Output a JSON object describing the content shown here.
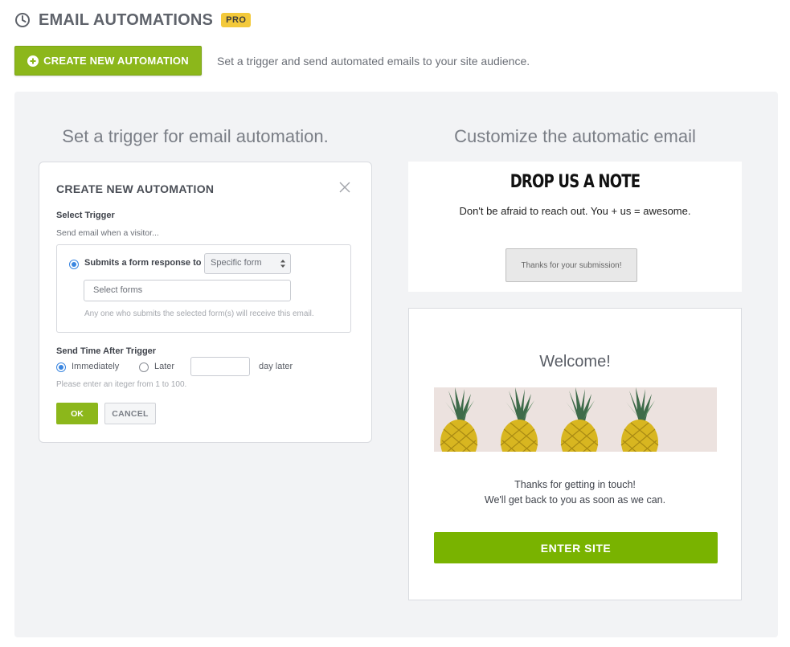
{
  "header": {
    "title": "EMAIL AUTOMATIONS",
    "badge": "PRO",
    "icon": "clock-icon"
  },
  "create": {
    "button_label": "CREATE NEW AUTOMATION",
    "description": "Set a trigger and send automated emails to your site audience."
  },
  "panel": {
    "left_heading": "Set a trigger for email automation.",
    "right_heading": "Customize the automatic email"
  },
  "dialog": {
    "title": "CREATE NEW AUTOMATION",
    "select_trigger_label": "Select Trigger",
    "send_when": "Send email when a visitor...",
    "submits_label": "Submits a form response to",
    "specific_select_value": "Specific form",
    "forms_input_placeholder": "Select forms",
    "any_one_note": "Any one who submits the selected form(s) will receive this email.",
    "send_time_label": "Send Time After Trigger",
    "immediately_label": "Immediately",
    "later_label": "Later",
    "days_value": "",
    "day_later_label": "day later",
    "hint": "Please enter an iteger  from 1 to 100.",
    "ok_label": "OK",
    "cancel_label": "CANCEL",
    "selected_trigger": "form",
    "selected_send_time": "immediately"
  },
  "note_card": {
    "title": "DROP US A NOTE",
    "subtitle": "Don't be afraid to reach out. You + us = awesome.",
    "thanks_button": "Thanks for your submission!"
  },
  "email_card": {
    "welcome": "Welcome!",
    "thanks_line1": "Thanks for getting in touch!",
    "thanks_line2": "We'll get back to you as soon as we can.",
    "enter_button": "ENTER SITE"
  },
  "colors": {
    "accent_green": "#8cb71b",
    "enter_green": "#79b300",
    "pro_yellow": "#f3c93b",
    "radio_blue": "#3a86e0"
  }
}
